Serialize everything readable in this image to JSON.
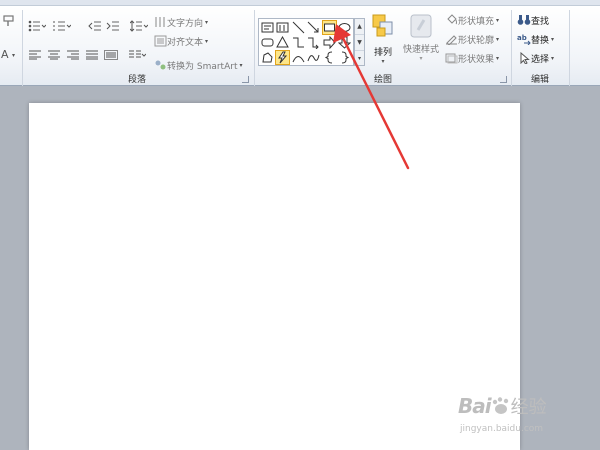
{
  "paragraph_group": {
    "label": "段落",
    "text_direction": "文字方向",
    "align_text": "对齐文本",
    "convert_smartart": "转换为 SmartArt"
  },
  "drawing_group": {
    "label": "绘图",
    "arrange": "排列",
    "quick_styles": "快速样式",
    "shape_fill": "形状填充",
    "shape_outline": "形状轮廓",
    "shape_effects": "形状效果",
    "selected_shape": "rectangle"
  },
  "editing_group": {
    "label": "编辑",
    "find": "查找",
    "replace": "替换",
    "select": "选择"
  },
  "watermark": {
    "brand": "Bai",
    "product": "经验",
    "url": "jingyan.baidu.com"
  }
}
